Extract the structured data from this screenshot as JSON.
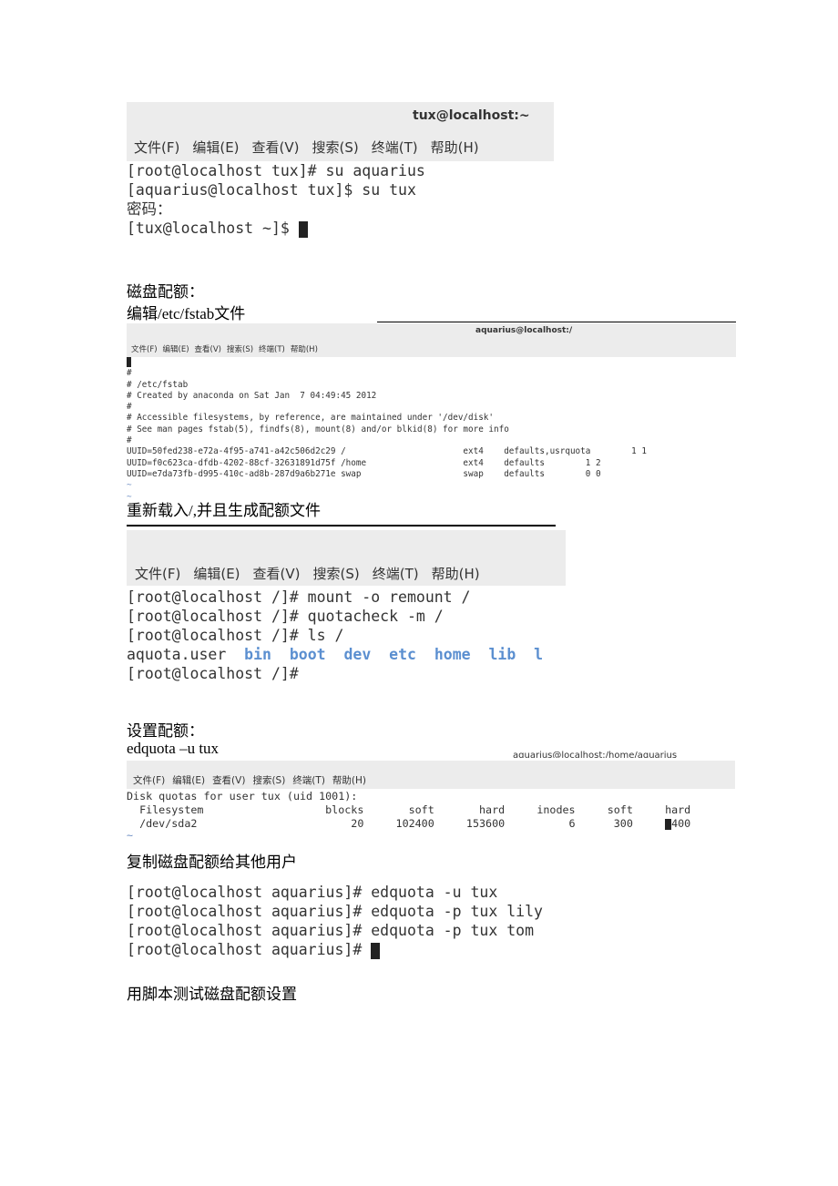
{
  "menu": [
    "文件(F)",
    "编辑(E)",
    "查看(V)",
    "搜索(S)",
    "终端(T)",
    "帮助(H)"
  ],
  "term1": {
    "title": "tux@localhost:~",
    "lines": [
      "[root@localhost tux]# su aquarius",
      "[aquarius@localhost tux]$ su tux",
      "密码：",
      "[tux@localhost ~]$ "
    ]
  },
  "section1": {
    "heading": "磁盘配额：",
    "subheading": "编辑/etc/fstab文件"
  },
  "term2": {
    "title": "aquarius@localhost:/",
    "lines": [
      "#",
      "# /etc/fstab",
      "# Created by anaconda on Sat Jan  7 04:49:45 2012",
      "#",
      "# Accessible filesystems, by reference, are maintained under '/dev/disk'",
      "# See man pages fstab(5), findfs(8), mount(8) and/or blkid(8) for more info",
      "#",
      "UUID=50fed238-e72a-4f95-a741-a42c506d2c29 /                       ext4    defaults,usrquota        1 1",
      "UUID=f0c623ca-dfdb-4202-88cf-32631891d75f /home                   ext4    defaults        1 2",
      "UUID=e7da73fb-d995-410c-ad8b-287d9a6b271e swap                    swap    defaults        0 0"
    ]
  },
  "section2": {
    "heading": "重新载入/,并且生成配额文件"
  },
  "term3": {
    "lines": [
      "[root@localhost /]# mount -o remount /",
      "[root@localhost /]# quotacheck -m /",
      "[root@localhost /]# ls /"
    ],
    "ls_file": "aquota.user",
    "ls_dirs": [
      "bin",
      "boot",
      "dev",
      "etc",
      "home",
      "lib",
      "l"
    ],
    "prompt": "[root@localhost /]#"
  },
  "section3": {
    "heading": "设置配额：",
    "command": "edquota –u tux"
  },
  "term4": {
    "title": "aquarius@localhost:/home/aquarius",
    "lines": [
      "Disk quotas for user tux (uid 1001):",
      "  Filesystem                   blocks       soft       hard     inodes     soft     hard",
      "  /dev/sda2                        20     102400     153600          6      300     "
    ],
    "last_value": "400"
  },
  "section4": {
    "heading": "复制磁盘配额给其他用户"
  },
  "term5": {
    "lines": [
      "[root@localhost aquarius]# edquota -u tux",
      "[root@localhost aquarius]# edquota -p tux lily",
      "[root@localhost aquarius]# edquota -p tux tom",
      "[root@localhost aquarius]# "
    ]
  },
  "section5": {
    "heading": "用脚本测试磁盘配额设置"
  }
}
